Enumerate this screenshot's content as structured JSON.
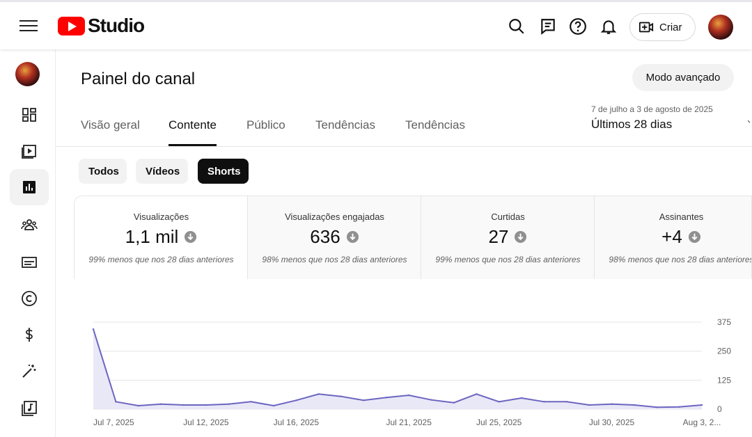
{
  "header": {
    "logo_text": "Studio",
    "create_label": "Criar"
  },
  "page": {
    "title": "Painel do canal",
    "advanced_label": "Modo avançado",
    "date_range": "7 de julho a 3 de agosto de 2025",
    "period": "Últimos 28 dias"
  },
  "tabs": [
    {
      "label": "Visão geral"
    },
    {
      "label": "Contente"
    },
    {
      "label": "Público"
    },
    {
      "label": "Tendências"
    },
    {
      "label": "Tendências"
    }
  ],
  "filters": [
    {
      "label": "Todos"
    },
    {
      "label": "Vídeos"
    },
    {
      "label": "Shorts"
    }
  ],
  "metrics": [
    {
      "label": "Visualizações",
      "value": "1,1 mil",
      "sub": "99% menos que nos 28 dias anteriores"
    },
    {
      "label": "Visualizações engajadas",
      "value": "636",
      "sub": "98% menos que nos 28 dias anteriores"
    },
    {
      "label": "Curtidas",
      "value": "27",
      "sub": "99% menos que nos 28 dias anteriores"
    },
    {
      "label": "Assinantes",
      "value": "+4",
      "sub": "98% menos que nos 28 dias anteriores"
    }
  ],
  "icons": {
    "sidebar": [
      "dashboard-icon",
      "content-icon",
      "analytics-icon",
      "community-icon",
      "subtitles-icon",
      "copyright-icon",
      "earn-icon",
      "customization-icon",
      "audio-library-icon"
    ],
    "top": [
      "search-icon",
      "comments-icon",
      "help-icon",
      "notifications-icon",
      "create-video-icon"
    ]
  },
  "colors": {
    "accent": "#ff0000",
    "line": "#6b65c0",
    "fill": "#e9e8f7"
  },
  "chart_data": {
    "type": "area",
    "x": [
      "Jul 7, 2025",
      "Jul 8",
      "Jul 9",
      "Jul 10",
      "Jul 11",
      "Jul 12, 2025",
      "Jul 13",
      "Jul 14",
      "Jul 15",
      "Jul 16, 2025",
      "Jul 17",
      "Jul 18",
      "Jul 19",
      "Jul 20",
      "Jul 21, 2025",
      "Jul 22",
      "Jul 23",
      "Jul 24",
      "Jul 25, 2025",
      "Jul 26",
      "Jul 27",
      "Jul 28",
      "Jul 29",
      "Jul 30, 2025",
      "Jul 31",
      "Aug 1",
      "Aug 2",
      "Aug 3, 2..."
    ],
    "series": [
      {
        "values": [
          345,
          32,
          15,
          22,
          18,
          18,
          22,
          32,
          15,
          38,
          65,
          55,
          38,
          50,
          60,
          40,
          28,
          65,
          32,
          48,
          32,
          32,
          18,
          22,
          18,
          8,
          10,
          18
        ]
      }
    ],
    "x_tick_labels": [
      "Jul 7, 2025",
      "Jul 12, 2025",
      "Jul 16, 2025",
      "Jul 21, 2025",
      "Jul 25, 2025",
      "Jul 30, 2025",
      "Aug 3, 2..."
    ],
    "y_tick_labels": [
      "0",
      "125",
      "250",
      "375"
    ],
    "ylim": [
      0,
      375
    ],
    "grid": true
  }
}
